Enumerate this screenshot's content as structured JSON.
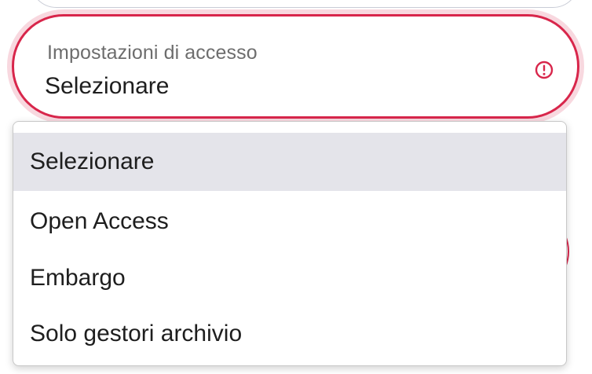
{
  "select": {
    "label": "Impostazioni di accesso",
    "value": "Selezionare",
    "state": "error",
    "error_icon": "exclamation-circle-icon",
    "error_color": "#d8264b"
  },
  "dropdown": {
    "options": [
      {
        "label": "Selezionare",
        "highlighted": true
      },
      {
        "label": "Open Access",
        "highlighted": false
      },
      {
        "label": "Embargo",
        "highlighted": false
      },
      {
        "label": "Solo gestori archivio",
        "highlighted": false
      }
    ],
    "highlight_color": "#e4e4ea"
  }
}
